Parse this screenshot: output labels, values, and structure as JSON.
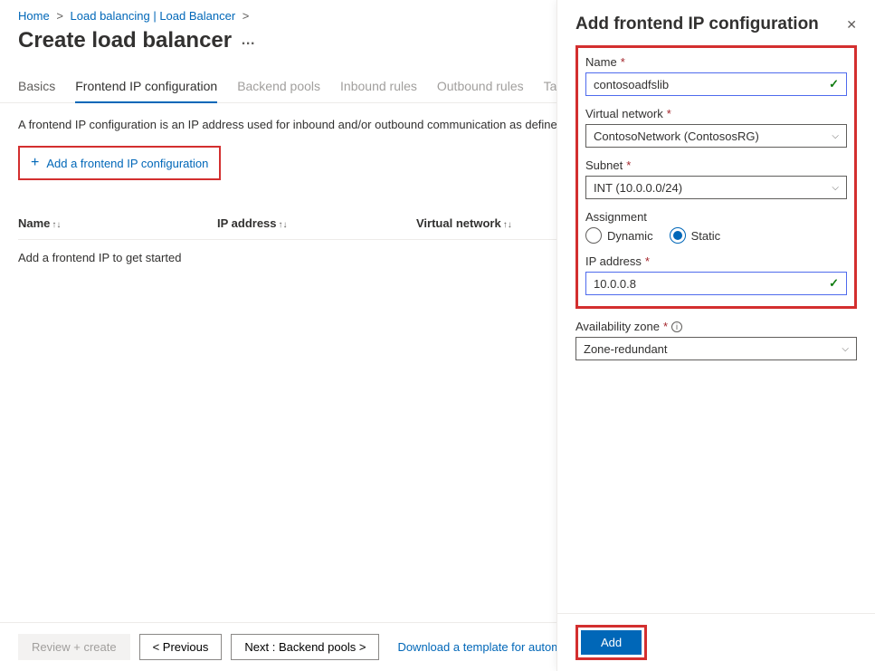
{
  "breadcrumb": {
    "home": "Home",
    "lb": "Load balancing | Load Balancer"
  },
  "page_title": "Create load balancer",
  "tabs": {
    "basics": "Basics",
    "frontend": "Frontend IP configuration",
    "backend": "Backend pools",
    "inbound": "Inbound rules",
    "outbound": "Outbound rules",
    "tags": "Tags"
  },
  "description": "A frontend IP configuration is an IP address used for inbound and/or outbound communication as defined withi",
  "add_button": "Add a frontend IP configuration",
  "columns": {
    "name": "Name",
    "ip": "IP address",
    "vnet": "Virtual network"
  },
  "empty_row": "Add a frontend IP to get started",
  "footer": {
    "review": "Review + create",
    "prev": "< Previous",
    "next": "Next : Backend pools >",
    "template": "Download a template for automati"
  },
  "panel": {
    "title": "Add frontend IP configuration",
    "labels": {
      "name": "Name",
      "vnet": "Virtual network",
      "subnet": "Subnet",
      "assignment": "Assignment",
      "dynamic": "Dynamic",
      "static": "Static",
      "ipaddr": "IP address",
      "azone": "Availability zone"
    },
    "values": {
      "name": "contosoadfslib",
      "vnet": "ContosoNetwork (ContososRG)",
      "subnet": "INT (10.0.0.0/24)",
      "ipaddr": "10.0.0.8",
      "azone": "Zone-redundant"
    },
    "add": "Add"
  }
}
